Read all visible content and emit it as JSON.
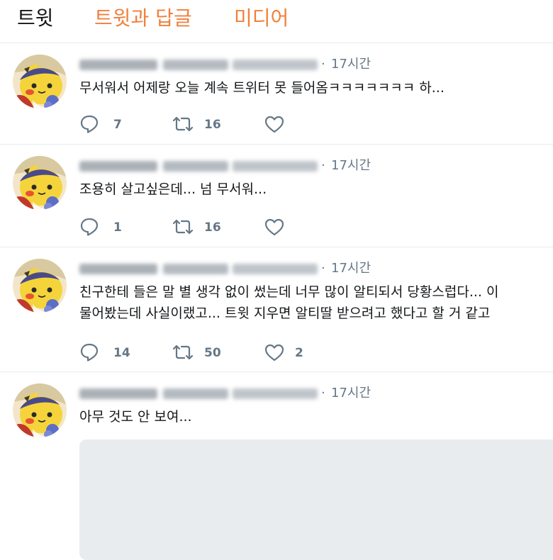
{
  "tabs": [
    {
      "label": "트윗"
    },
    {
      "label": "트윗과 답글"
    },
    {
      "label": "미디어"
    }
  ],
  "colors": {
    "accent": "#f0803c",
    "muted": "#657786",
    "divider": "#e6ecf0"
  },
  "tweets": [
    {
      "time": "17시간",
      "text_lines": [
        "무서워서 어제랑 오늘 계속 트위터 못 들어옴ㅋㅋㅋㅋㅋㅋㅋ 하..."
      ],
      "replies": "7",
      "retweets": "16",
      "likes": ""
    },
    {
      "time": "17시간",
      "text_lines": [
        "조용히 살고싶은데... 넘 무서워..."
      ],
      "replies": "1",
      "retweets": "16",
      "likes": ""
    },
    {
      "time": "17시간",
      "text_lines": [
        "친구한테 들은 말 별 생각 없이 썼는데 너무 많이 알티되서 당황스럽다... 이",
        "물어봤는데 사실이랬고... 트윗 지우면 알티딸 받으려고 했다고 할 거 같고"
      ],
      "replies": "14",
      "retweets": "50",
      "likes": "2"
    },
    {
      "time": "17시간",
      "text_lines": [
        "아무 것도 안 보여..."
      ]
    }
  ],
  "icons": {
    "reply": "reply-icon",
    "retweet": "retweet-icon",
    "like": "heart-icon"
  }
}
